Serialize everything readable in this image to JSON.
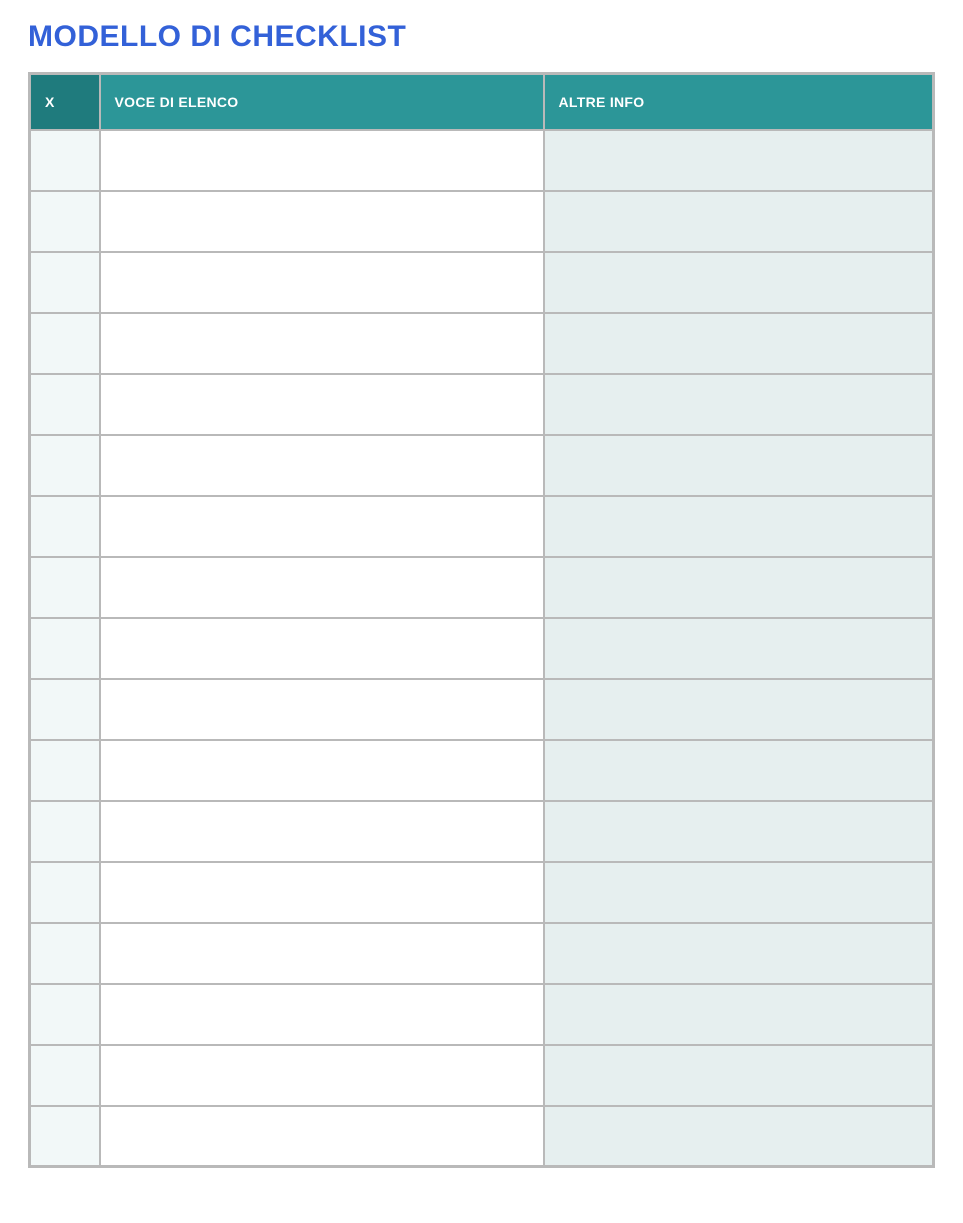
{
  "title": "MODELLO DI CHECKLIST",
  "headers": {
    "check": "X",
    "item": "VOCE DI ELENCO",
    "info": "ALTRE INFO"
  },
  "rows": [
    {
      "check": "",
      "item": "",
      "info": ""
    },
    {
      "check": "",
      "item": "",
      "info": ""
    },
    {
      "check": "",
      "item": "",
      "info": ""
    },
    {
      "check": "",
      "item": "",
      "info": ""
    },
    {
      "check": "",
      "item": "",
      "info": ""
    },
    {
      "check": "",
      "item": "",
      "info": ""
    },
    {
      "check": "",
      "item": "",
      "info": ""
    },
    {
      "check": "",
      "item": "",
      "info": ""
    },
    {
      "check": "",
      "item": "",
      "info": ""
    },
    {
      "check": "",
      "item": "",
      "info": ""
    },
    {
      "check": "",
      "item": "",
      "info": ""
    },
    {
      "check": "",
      "item": "",
      "info": ""
    },
    {
      "check": "",
      "item": "",
      "info": ""
    },
    {
      "check": "",
      "item": "",
      "info": ""
    },
    {
      "check": "",
      "item": "",
      "info": ""
    },
    {
      "check": "",
      "item": "",
      "info": ""
    },
    {
      "check": "",
      "item": "",
      "info": ""
    }
  ]
}
